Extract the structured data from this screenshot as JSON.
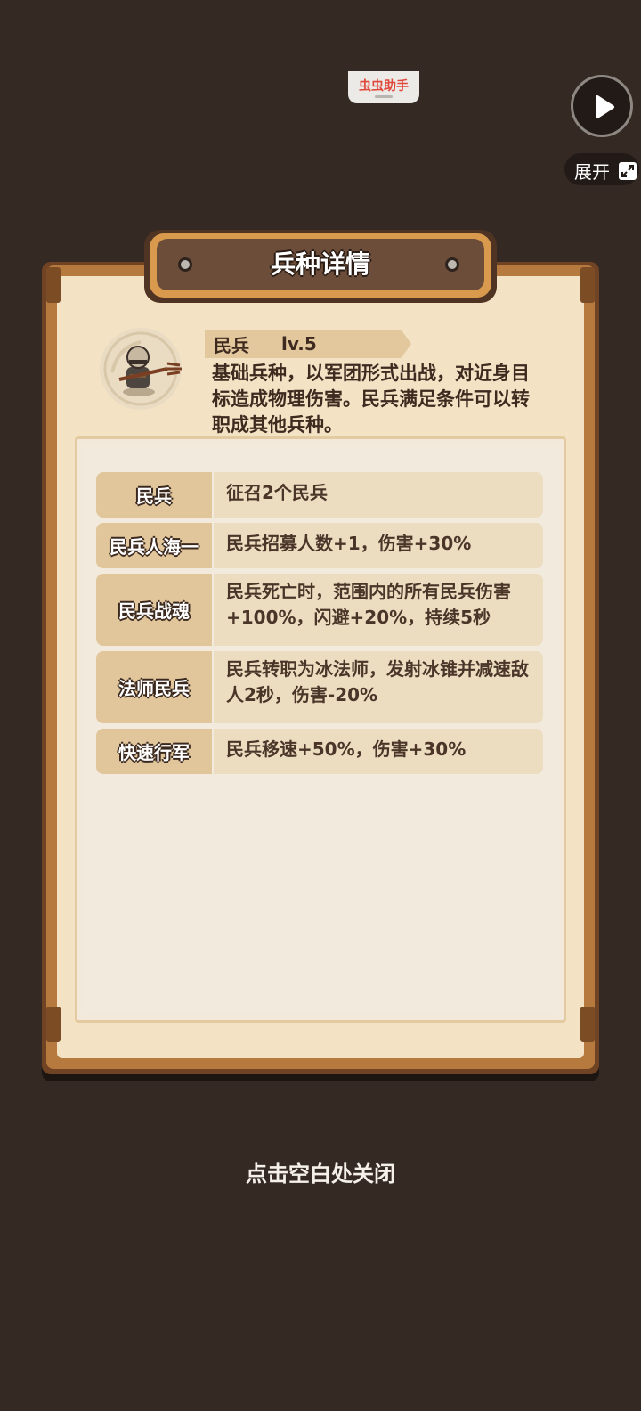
{
  "overlay": {
    "helper_label": "虫虫助手",
    "expand_label": "展开",
    "play_icon": "play-icon",
    "expand_icon": "expand-icon"
  },
  "panel": {
    "title": "兵种详情",
    "unit": {
      "name": "民兵",
      "level": "lv.5",
      "description": "基础兵种，以军团形式出战，对近身目标造成物理伤害。民兵满足条件可以转职成其他兵种。",
      "avatar": "militia-soldier-icon"
    },
    "skills": [
      {
        "name": "民兵",
        "desc": "征召2个民兵"
      },
      {
        "name": "民兵人海一",
        "desc": "民兵招募人数+1，伤害+30%"
      },
      {
        "name": "民兵战魂",
        "desc": "民兵死亡时，范围内的所有民兵伤害+100%，闪避+20%，持续5秒"
      },
      {
        "name": "法师民兵",
        "desc": "民兵转职为冰法师，发射冰锥并减速敌人2秒，伤害-20%"
      },
      {
        "name": "快速行军",
        "desc": "民兵移速+50%，伤害+30%"
      }
    ]
  },
  "close_hint": "点击空白处关闭",
  "colors": {
    "background": "#342923",
    "paper": "#f3e2c4",
    "frame": "#b67a3f",
    "label_bg": "#e2c69b",
    "desc_bg": "#ecdcc0",
    "text_dark": "#3f2a20"
  }
}
